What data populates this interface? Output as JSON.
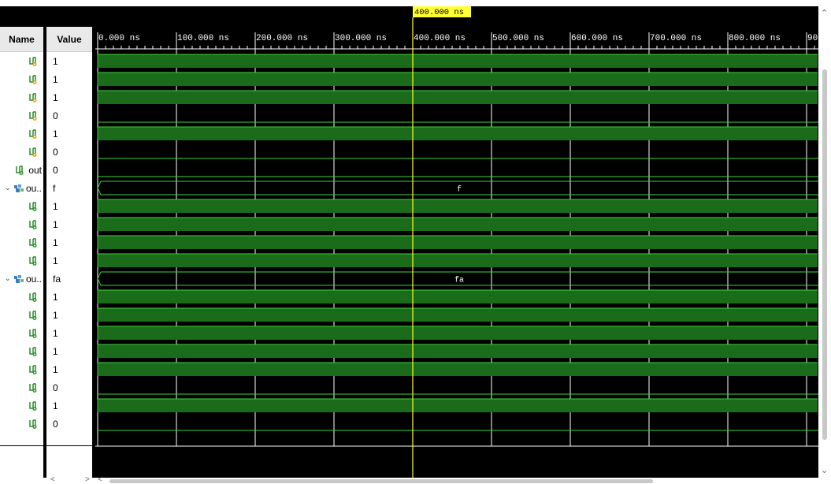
{
  "columns": {
    "name": "Name",
    "value": "Value"
  },
  "cursor": {
    "label": "400.000 ns",
    "time_ns": 400
  },
  "timeline": {
    "start_ns": 0,
    "ns_per_major": 100,
    "ticks": [
      "0.000 ns",
      "100.000 ns",
      "200.000 ns",
      "300.000 ns",
      "400.000 ns",
      "500.000 ns",
      "600.000 ns",
      "700.000 ns",
      "800.000 ns",
      "90"
    ]
  },
  "signals": [
    {
      "name": "",
      "value": "1",
      "kind": "input",
      "wave": "high"
    },
    {
      "name": "",
      "value": "1",
      "kind": "input",
      "wave": "high"
    },
    {
      "name": "",
      "value": "1",
      "kind": "input",
      "wave": "high"
    },
    {
      "name": "",
      "value": "0",
      "kind": "input",
      "wave": "low"
    },
    {
      "name": "",
      "value": "1",
      "kind": "input",
      "wave": "high"
    },
    {
      "name": "",
      "value": "0",
      "kind": "input",
      "wave": "low"
    },
    {
      "name": "out",
      "value": "0",
      "kind": "output",
      "wave": "low"
    },
    {
      "name": "ou..",
      "value": "f",
      "kind": "group",
      "wave": "bus",
      "bus_text": "f"
    },
    {
      "name": "",
      "value": "1",
      "kind": "output",
      "wave": "high"
    },
    {
      "name": "",
      "value": "1",
      "kind": "output",
      "wave": "high"
    },
    {
      "name": "",
      "value": "1",
      "kind": "output",
      "wave": "high"
    },
    {
      "name": "",
      "value": "1",
      "kind": "output",
      "wave": "high"
    },
    {
      "name": "ou..",
      "value": "fa",
      "kind": "group",
      "wave": "bus",
      "bus_text": "fa"
    },
    {
      "name": "",
      "value": "1",
      "kind": "output",
      "wave": "high"
    },
    {
      "name": "",
      "value": "1",
      "kind": "output",
      "wave": "high"
    },
    {
      "name": "",
      "value": "1",
      "kind": "output",
      "wave": "high"
    },
    {
      "name": "",
      "value": "1",
      "kind": "output",
      "wave": "high"
    },
    {
      "name": "",
      "value": "1",
      "kind": "output",
      "wave": "high"
    },
    {
      "name": "",
      "value": "0",
      "kind": "output",
      "wave": "low"
    },
    {
      "name": "",
      "value": "1",
      "kind": "output",
      "wave": "high"
    },
    {
      "name": "",
      "value": "0",
      "kind": "output",
      "wave": "low"
    }
  ],
  "colors": {
    "wave_high": "#1a6b1a",
    "wave_line": "#3cd23c",
    "grid": "#ffffff",
    "cursor": "#ffff33",
    "cursor_label_bg": "#ffff33"
  },
  "icons": {
    "input": "input-signal-icon",
    "output": "output-signal-icon",
    "group": "bus-group-icon",
    "expand": "chevron-down-icon"
  }
}
